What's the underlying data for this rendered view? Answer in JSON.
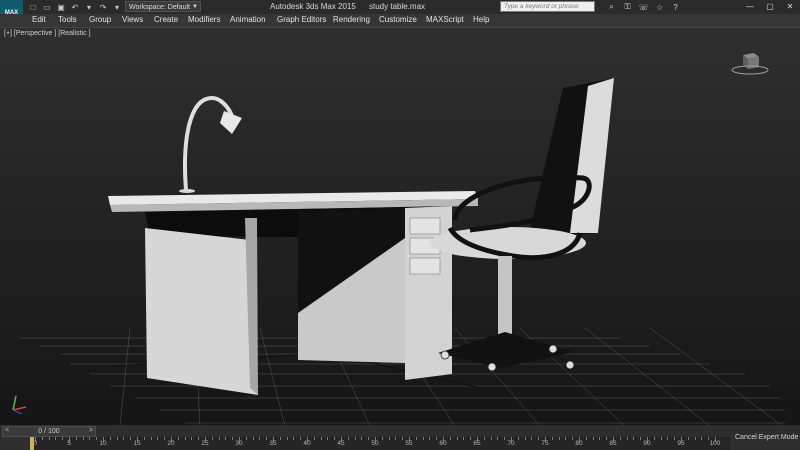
{
  "app": {
    "logo_text": "MAX",
    "title": "Autodesk 3ds Max  2015",
    "file": "study table.max"
  },
  "workspace": {
    "label": "Workspace: Default"
  },
  "search": {
    "placeholder": "Type a keyword or phrase"
  },
  "menu": [
    "Edit",
    "Tools",
    "Group",
    "Views",
    "Create",
    "Modifiers",
    "Animation",
    "Graph Editors",
    "Rendering",
    "Customize",
    "MAXScript",
    "Help"
  ],
  "viewport": {
    "label": "[+] [Perspective ] [Realistic ]"
  },
  "timeline": {
    "slider_text": "0 / 100",
    "ticks": [
      "0",
      "5",
      "10",
      "15",
      "20",
      "25",
      "30",
      "35",
      "40",
      "45",
      "50",
      "55",
      "60",
      "65",
      "70",
      "75",
      "80",
      "85",
      "90",
      "95",
      "100"
    ]
  },
  "status": {
    "cancel_expert": "Cancel Expert Mode"
  },
  "colors": {
    "title_bg": "#2b2b2b",
    "menu_bg": "#363636",
    "accent": "#0f5a6b"
  }
}
